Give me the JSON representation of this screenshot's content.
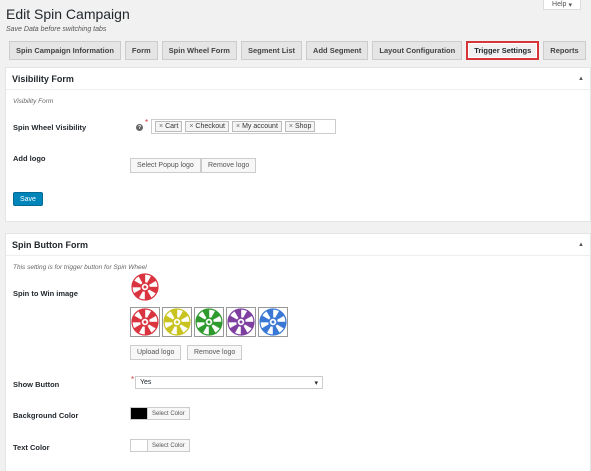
{
  "help": {
    "label": "Help",
    "arrow": "▾"
  },
  "page": {
    "title": "Edit Spin Campaign",
    "subtitle": "Save Data before switching tabs"
  },
  "tabs": [
    {
      "label": "Spin Campaign Information"
    },
    {
      "label": "Form"
    },
    {
      "label": "Spin Wheel Form"
    },
    {
      "label": "Segment List"
    },
    {
      "label": "Add Segment"
    },
    {
      "label": "Layout Configuration"
    },
    {
      "label": "Trigger Settings",
      "active": true
    },
    {
      "label": "Reports"
    }
  ],
  "visibility": {
    "title": "Visibility Form",
    "toggle": "▲",
    "description": "Visibility Form",
    "wheel_visibility_label": "Spin Wheel Visibility",
    "help_icon": "?",
    "required": "*",
    "selected": [
      "Cart",
      "Checkout",
      "My account",
      "Shop"
    ],
    "remove_glyph": "×",
    "logo_label": "Add logo",
    "select_logo": "Select Popup logo",
    "remove_logo": "Remove logo",
    "save": "Save"
  },
  "spin_button": {
    "title": "Spin Button Form",
    "toggle": "▲",
    "description": "This setting is for trigger button for Spin Wheel",
    "image_label": "Spin to Win image",
    "wheel_options": [
      {
        "name": "red-wheel",
        "color": "#d9343f"
      },
      {
        "name": "yellow-green-wheel",
        "color": "#c8c31e"
      },
      {
        "name": "green-wheel",
        "color": "#2f9a2d"
      },
      {
        "name": "purple-green-wheel",
        "color": "#7f3fa0"
      },
      {
        "name": "blue-wheel",
        "color": "#3a78d6"
      }
    ],
    "upload_logo": "Upload logo",
    "remove_logo": "Remove logo",
    "show_button_label": "Show Button",
    "required": "*",
    "show_button_value": "Yes",
    "show_button_arrow": "▾",
    "bg_color_label": "Background Color",
    "bg_color_value": "#000000",
    "bg_color_button": "Select Color",
    "text_color_label": "Text Color",
    "text_color_value": "#ffffff",
    "text_color_button": "Select Color"
  }
}
